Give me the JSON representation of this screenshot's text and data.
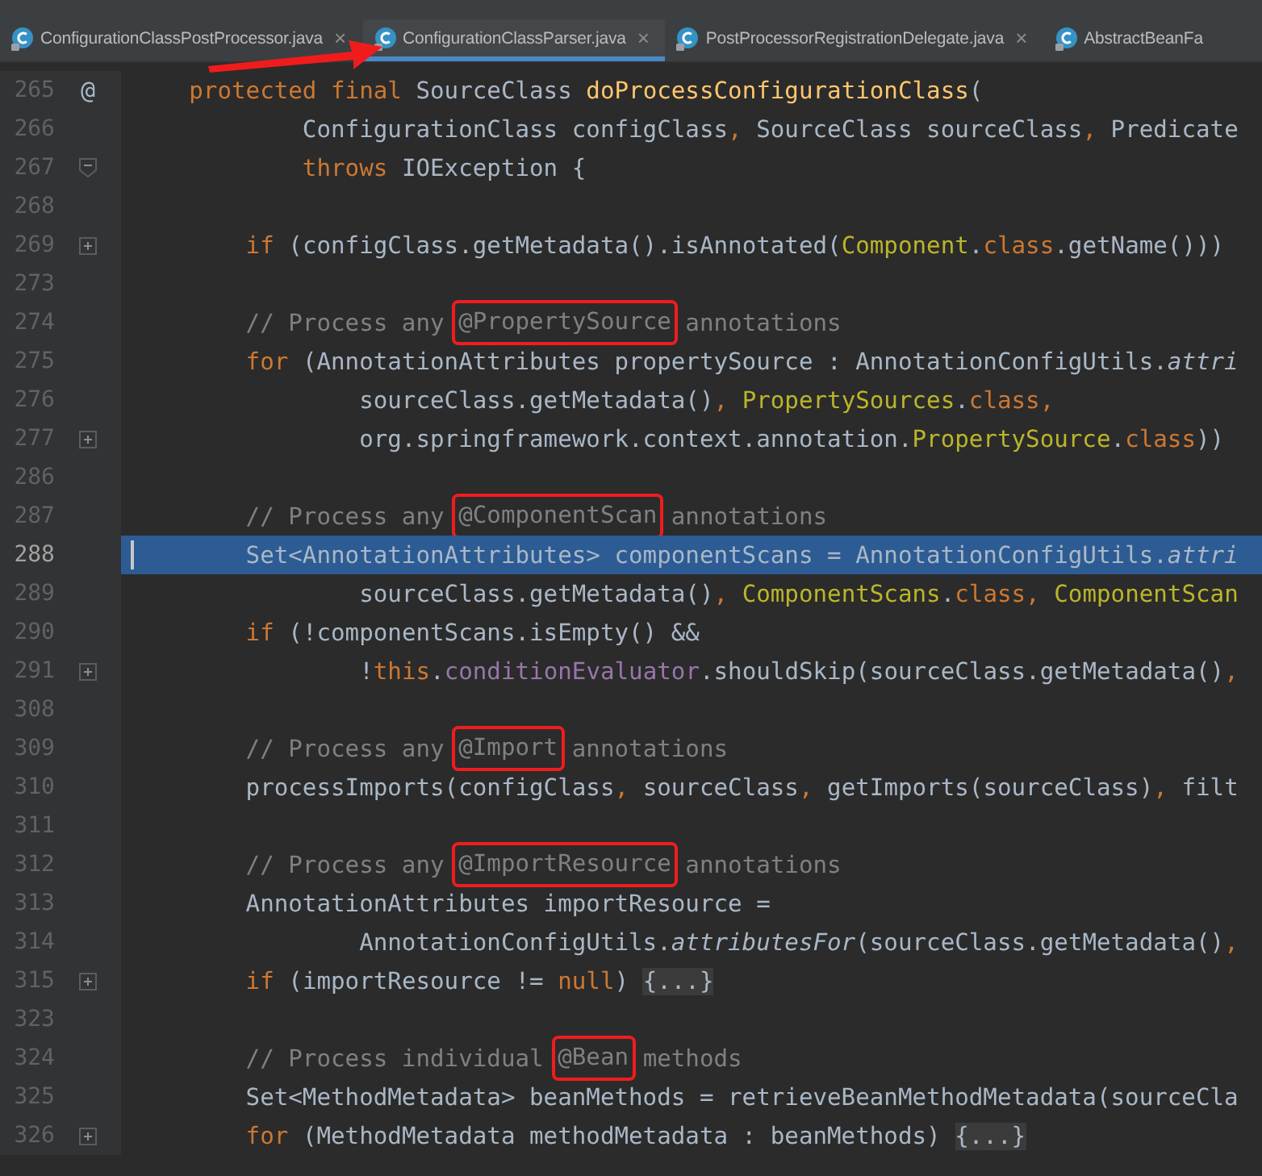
{
  "tabs": [
    {
      "label": "ConfigurationClassPostProcessor.java",
      "selected": false,
      "close": "×"
    },
    {
      "label": "ConfigurationClassParser.java",
      "selected": true,
      "close": "×"
    },
    {
      "label": "PostProcessorRegistrationDelegate.java",
      "selected": false,
      "close": "×"
    },
    {
      "label": "AbstractBeanFa",
      "selected": false
    }
  ],
  "editor": {
    "lines": [
      {
        "number": "265",
        "current": false,
        "marker": {
          "kind": "text",
          "text": "@"
        },
        "tokens": [
          {
            "kind": "kw",
            "text": "    protected final "
          },
          {
            "kind": "plain",
            "text": "SourceClass "
          },
          {
            "kind": "decl",
            "text": "doProcessConfigurationClass"
          },
          {
            "kind": "plain",
            "text": "("
          }
        ]
      },
      {
        "number": "266",
        "current": false,
        "tokens": [
          {
            "kind": "plain",
            "text": "            ConfigurationClass configClass"
          },
          {
            "kind": "kw",
            "text": ", "
          },
          {
            "kind": "plain",
            "text": "SourceClass sourceClass"
          },
          {
            "kind": "kw",
            "text": ", "
          },
          {
            "kind": "plain",
            "text": "Predicate"
          }
        ]
      },
      {
        "number": "267",
        "current": false,
        "marker": {
          "kind": "fold-end"
        },
        "tokens": [
          {
            "kind": "kw",
            "text": "            throws "
          },
          {
            "kind": "plain",
            "text": "IOException {"
          }
        ]
      },
      {
        "number": "268",
        "current": false
      },
      {
        "number": "269",
        "current": false,
        "marker": {
          "kind": "fold"
        },
        "tokens": [
          {
            "kind": "kw",
            "text": "        if "
          },
          {
            "kind": "plain",
            "text": "(configClass.getMetadata().isAnnotated("
          },
          {
            "kind": "type",
            "text": "Component"
          },
          {
            "kind": "plain",
            "text": "."
          },
          {
            "kind": "kw",
            "text": "class"
          },
          {
            "kind": "plain",
            "text": ".getName()))"
          }
        ]
      },
      {
        "number": "273",
        "current": false
      },
      {
        "number": "274",
        "current": false,
        "tokens": [
          {
            "kind": "comment",
            "text": "        // Process any "
          },
          {
            "kind": "boxed",
            "text": "@PropertySource"
          },
          {
            "kind": "comment",
            "text": " annotations"
          }
        ]
      },
      {
        "number": "275",
        "current": false,
        "tokens": [
          {
            "kind": "kw",
            "text": "        for "
          },
          {
            "kind": "plain",
            "text": "(AnnotationAttributes propertySource : AnnotationConfigUtils."
          },
          {
            "kind": "italic",
            "text": "attri"
          }
        ]
      },
      {
        "number": "276",
        "current": false,
        "tokens": [
          {
            "kind": "plain",
            "text": "                sourceClass.getMetadata()"
          },
          {
            "kind": "kw",
            "text": ", "
          },
          {
            "kind": "type",
            "text": "PropertySources"
          },
          {
            "kind": "plain",
            "text": "."
          },
          {
            "kind": "kw",
            "text": "class,"
          }
        ]
      },
      {
        "number": "277",
        "current": false,
        "marker": {
          "kind": "fold"
        },
        "tokens": [
          {
            "kind": "plain",
            "text": "                org.springframework.context.annotation."
          },
          {
            "kind": "type",
            "text": "PropertySource"
          },
          {
            "kind": "plain",
            "text": "."
          },
          {
            "kind": "kw",
            "text": "class"
          },
          {
            "kind": "plain",
            "text": "))"
          }
        ]
      },
      {
        "number": "286",
        "current": false
      },
      {
        "number": "287",
        "current": false,
        "tokens": [
          {
            "kind": "comment",
            "text": "        // Process any "
          },
          {
            "kind": "boxed",
            "text": "@ComponentScan"
          },
          {
            "kind": "comment",
            "text": " annotations"
          }
        ]
      },
      {
        "number": "288",
        "current": true,
        "tokens": [
          {
            "kind": "plain",
            "text": "        Set<AnnotationAttributes> componentScans = AnnotationConfigUtils."
          },
          {
            "kind": "italic",
            "text": "attri"
          }
        ]
      },
      {
        "number": "289",
        "current": false,
        "tokens": [
          {
            "kind": "plain",
            "text": "                sourceClass.getMetadata()"
          },
          {
            "kind": "kw",
            "text": ", "
          },
          {
            "kind": "type",
            "text": "ComponentScans"
          },
          {
            "kind": "plain",
            "text": "."
          },
          {
            "kind": "kw",
            "text": "class, "
          },
          {
            "kind": "type",
            "text": "ComponentScan"
          }
        ]
      },
      {
        "number": "290",
        "current": false,
        "tokens": [
          {
            "kind": "kw",
            "text": "        if "
          },
          {
            "kind": "plain",
            "text": "(!componentScans.isEmpty() &&"
          }
        ]
      },
      {
        "number": "291",
        "current": false,
        "marker": {
          "kind": "fold"
        },
        "tokens": [
          {
            "kind": "plain",
            "text": "                !"
          },
          {
            "kind": "kw",
            "text": "this"
          },
          {
            "kind": "plain",
            "text": "."
          },
          {
            "kind": "field",
            "text": "conditionEvaluator"
          },
          {
            "kind": "plain",
            "text": ".shouldSkip(sourceClass.getMetadata()"
          },
          {
            "kind": "kw",
            "text": ","
          }
        ]
      },
      {
        "number": "308",
        "current": false
      },
      {
        "number": "309",
        "current": false,
        "tokens": [
          {
            "kind": "comment",
            "text": "        // Process any "
          },
          {
            "kind": "boxed",
            "text": "@Import"
          },
          {
            "kind": "comment",
            "text": " annotations"
          }
        ]
      },
      {
        "number": "310",
        "current": false,
        "tokens": [
          {
            "kind": "plain",
            "text": "        processImports(configClass"
          },
          {
            "kind": "kw",
            "text": ", "
          },
          {
            "kind": "plain",
            "text": "sourceClass"
          },
          {
            "kind": "kw",
            "text": ", "
          },
          {
            "kind": "plain",
            "text": "getImports(sourceClass)"
          },
          {
            "kind": "kw",
            "text": ", "
          },
          {
            "kind": "plain",
            "text": "filt"
          }
        ]
      },
      {
        "number": "311",
        "current": false
      },
      {
        "number": "312",
        "current": false,
        "tokens": [
          {
            "kind": "comment",
            "text": "        // Process any "
          },
          {
            "kind": "boxed",
            "text": "@ImportResource"
          },
          {
            "kind": "comment",
            "text": " annotations"
          }
        ]
      },
      {
        "number": "313",
        "current": false,
        "tokens": [
          {
            "kind": "plain",
            "text": "        AnnotationAttributes importResource ="
          }
        ]
      },
      {
        "number": "314",
        "current": false,
        "tokens": [
          {
            "kind": "plain",
            "text": "                AnnotationConfigUtils."
          },
          {
            "kind": "italic",
            "text": "attributesFor"
          },
          {
            "kind": "plain",
            "text": "(sourceClass.getMetadata()"
          },
          {
            "kind": "kw",
            "text": ","
          }
        ]
      },
      {
        "number": "315",
        "current": false,
        "marker": {
          "kind": "fold"
        },
        "tokens": [
          {
            "kind": "kw",
            "text": "        if "
          },
          {
            "kind": "plain",
            "text": "(importResource != "
          },
          {
            "kind": "kw",
            "text": "null"
          },
          {
            "kind": "plain",
            "text": ") "
          },
          {
            "kind": "folded",
            "text": "{...}"
          }
        ]
      },
      {
        "number": "323",
        "current": false
      },
      {
        "number": "324",
        "current": false,
        "tokens": [
          {
            "kind": "comment",
            "text": "        // Process individual "
          },
          {
            "kind": "boxed",
            "text": "@Bean"
          },
          {
            "kind": "comment",
            "text": " methods"
          }
        ]
      },
      {
        "number": "325",
        "current": false,
        "tokens": [
          {
            "kind": "plain",
            "text": "        Set<MethodMetadata> beanMethods = retrieveBeanMethodMetadata(sourceCla"
          }
        ]
      },
      {
        "number": "326",
        "current": false,
        "marker": {
          "kind": "fold"
        },
        "tokens": [
          {
            "kind": "kw",
            "text": "        for "
          },
          {
            "kind": "plain",
            "text": "(MethodMetadata methodMetadata : beanMethods) "
          },
          {
            "kind": "folded",
            "text": "{...}"
          }
        ]
      }
    ]
  }
}
